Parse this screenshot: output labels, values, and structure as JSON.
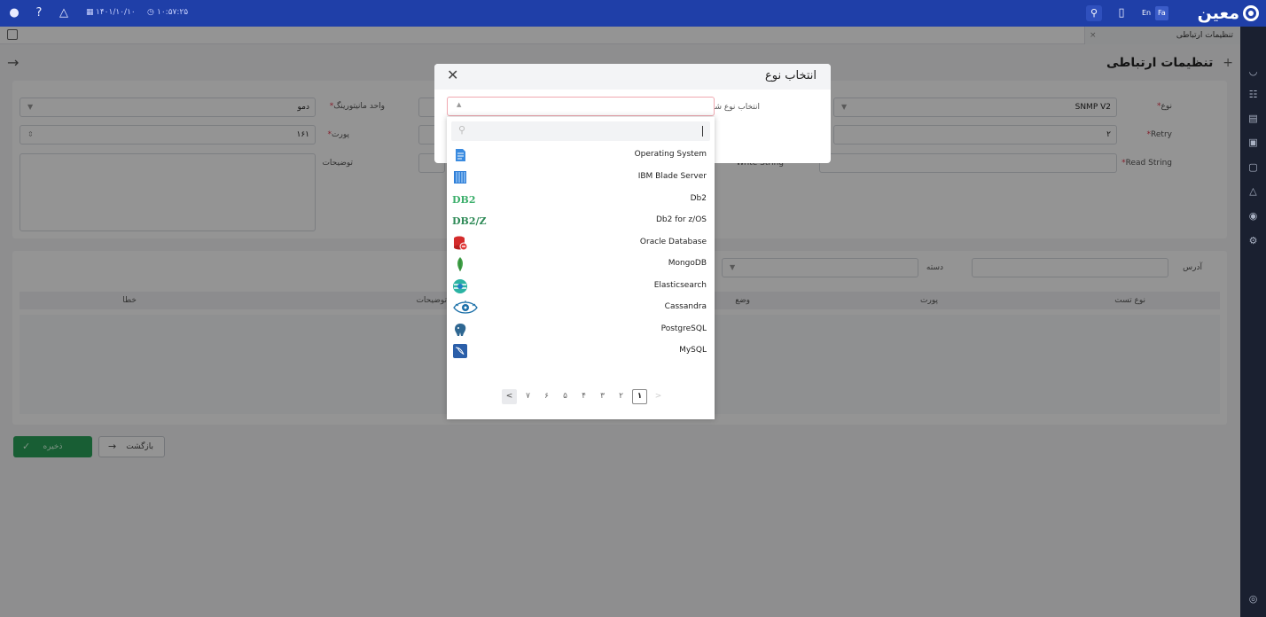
{
  "topbar": {
    "datetime_date": "۱۴۰۱/۱۰/۱۰",
    "datetime_time": "۱۰:۵۷:۲۵",
    "lang_en": "En",
    "lang_fa": "Fa",
    "logo_text": "معین"
  },
  "tab": {
    "label": "تنظیمات ارتباطی",
    "close": "×"
  },
  "page": {
    "title": "تنظیمات ارتباطی",
    "plus": "+"
  },
  "form": {
    "type_label": "نوع",
    "type_value": "SNMP V2",
    "monitoring_unit_label": "واحد مانیتورینگ",
    "monitoring_unit_value": "دمو",
    "retry_label": "Retry",
    "retry_value": "۲",
    "port_label": "پورت",
    "port_value": "۱۶۱",
    "read_string_label": "Read String",
    "write_string_label": "Write String",
    "description_label": "توضیحات"
  },
  "table": {
    "address_label": "آدرس",
    "category_label": "دسته",
    "columns": [
      "نوع تست",
      "پورت",
      "وضع",
      "توضیحات",
      "خطا"
    ]
  },
  "buttons": {
    "save": "ذخیره",
    "back": "بازگشت"
  },
  "modal": {
    "title": "انتخاب نوع",
    "object_type_label": "انتخاب نوع شیء"
  },
  "dropdown": {
    "items": [
      {
        "name": "Operating System",
        "icon": "server-doc-icon"
      },
      {
        "name": "IBM Blade Server",
        "icon": "blade-server-icon"
      },
      {
        "name": "Db2",
        "icon": "db2-logo-icon"
      },
      {
        "name": "Db2 for z/OS",
        "icon": "db2z-logo-icon"
      },
      {
        "name": "Oracle Database",
        "icon": "oracle-db-icon"
      },
      {
        "name": "MongoDB",
        "icon": "mongodb-leaf-icon"
      },
      {
        "name": "Elasticsearch",
        "icon": "elasticsearch-icon"
      },
      {
        "name": "Cassandra",
        "icon": "cassandra-eye-icon"
      },
      {
        "name": "PostgreSQL",
        "icon": "postgresql-elephant-icon"
      },
      {
        "name": "MySQL",
        "icon": "mysql-dolphin-icon"
      }
    ],
    "logo_text_db2": "DB2",
    "logo_text_db2z": "DB2/Z",
    "pages": [
      "۱",
      "۲",
      "۳",
      "۴",
      "۵",
      "۶",
      "۷"
    ],
    "current_page": "۱"
  },
  "colors": {
    "brand": "#1f3fa8",
    "save": "#2aa35a",
    "required": "#e53950"
  }
}
